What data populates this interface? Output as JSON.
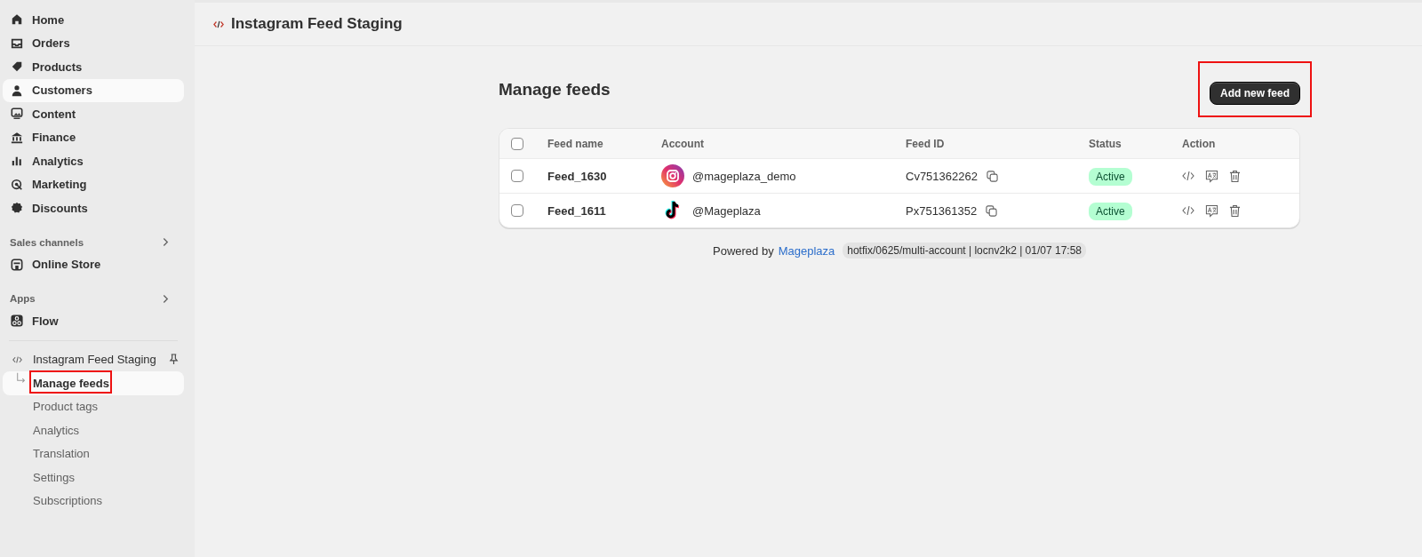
{
  "sidebar": {
    "items": [
      {
        "label": "Home",
        "kind": "home",
        "selected": false
      },
      {
        "label": "Orders",
        "kind": "inbox",
        "selected": false
      },
      {
        "label": "Products",
        "kind": "tag",
        "selected": false
      },
      {
        "label": "Customers",
        "kind": "person",
        "selected": true
      },
      {
        "label": "Content",
        "kind": "image",
        "selected": false
      },
      {
        "label": "Finance",
        "kind": "bank",
        "selected": false
      },
      {
        "label": "Analytics",
        "kind": "bars",
        "selected": false
      },
      {
        "label": "Marketing",
        "kind": "target",
        "selected": false
      },
      {
        "label": "Discounts",
        "kind": "badge",
        "selected": false
      }
    ],
    "sections": [
      {
        "title": "Sales channels",
        "items": [
          {
            "label": "Online Store",
            "kind": "store",
            "selected": false
          }
        ]
      },
      {
        "title": "Apps",
        "items": [
          {
            "label": "Flow",
            "kind": "flow",
            "selected": false
          }
        ]
      }
    ],
    "app": {
      "name": "Instagram Feed Staging",
      "subitems": [
        {
          "label": "Manage feeds",
          "selected": true,
          "highlighted": true
        },
        {
          "label": "Product tags",
          "selected": false,
          "highlighted": false
        },
        {
          "label": "Analytics",
          "selected": false,
          "highlighted": false
        },
        {
          "label": "Translation",
          "selected": false,
          "highlighted": false
        },
        {
          "label": "Settings",
          "selected": false,
          "highlighted": false
        },
        {
          "label": "Subscriptions",
          "selected": false,
          "highlighted": false
        }
      ]
    }
  },
  "header": {
    "title": "Instagram Feed Staging"
  },
  "page": {
    "title": "Manage feeds",
    "add_button": {
      "label": "Add new feed",
      "highlighted": true
    }
  },
  "table": {
    "select_all_checked": false,
    "columns": [
      "Feed name",
      "Account",
      "Feed ID",
      "Status",
      "Action"
    ],
    "rows": [
      {
        "checked": false,
        "name": "Feed_1630",
        "kind": "instagram",
        "account": "@mageplaza_demo",
        "feed_id": "Cv751362262",
        "status": "Active"
      },
      {
        "checked": false,
        "name": "Feed_1611",
        "kind": "tiktok",
        "account": "@Mageplaza",
        "feed_id": "Px751361352",
        "status": "Active"
      }
    ]
  },
  "footer": {
    "prefix": "Powered by",
    "link": "Mageplaza",
    "build": "hotfix/0625/multi-account | locnv2k2 | 01/07 17:58"
  }
}
